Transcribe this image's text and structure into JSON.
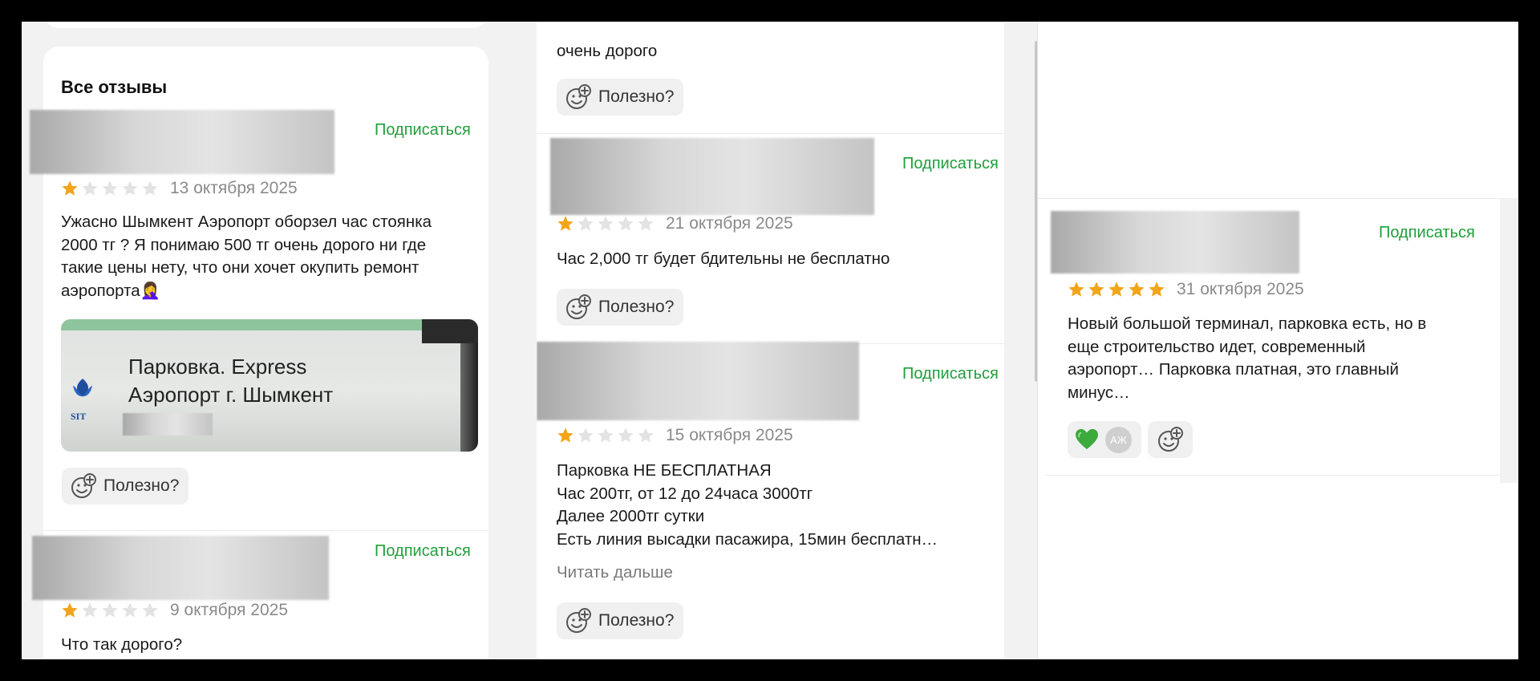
{
  "colors": {
    "accent": "#1f9f3a",
    "star": "#f2a51a",
    "star_empty": "#e3e3e3",
    "background": "#f2f2f2"
  },
  "left": {
    "heading": "Все отзывы",
    "reviews": [
      {
        "subscribe": "Подписаться",
        "rating": 1,
        "date": "13 октября 2025",
        "text": "Ужасно Шымкент Аэропорт оборзел час стоянка\n2000 тг ? Я понимаю 500 тг очень дорого ни где\nтакие цены нету, что они хочет окупить ремонт\nаэропорта🤦‍♀️",
        "photo": {
          "line1": "Парковка. Express",
          "line2": "Аэропорт г. Шымкент",
          "logo": "SIT"
        },
        "useful": "Полезно?"
      },
      {
        "subscribe": "Подписаться",
        "rating": 1,
        "date": "9 октября 2025",
        "text": "Что так дорого?"
      }
    ]
  },
  "middle": {
    "reviews": [
      {
        "text": "очень дорого",
        "useful": "Полезно?"
      },
      {
        "subscribe": "Подписаться",
        "rating": 1,
        "date": "21 октября 2025",
        "text": "Час 2,000 тг будет бдительны не бесплатно",
        "useful": "Полезно?"
      },
      {
        "subscribe": "Подписаться",
        "rating": 1,
        "date": "15 октября 2025",
        "text": "Парковка НЕ БЕСПЛАТНАЯ\nЧас 200тг, от 12 до 24часа 3000тг\nДалее 2000тг сутки\nЕсть линия высадки пасажира, 15мин бесплатн…",
        "read_more": "Читать дальше",
        "useful": "Полезно?"
      }
    ]
  },
  "right": {
    "reviews": [
      {
        "subscribe": "Подписаться",
        "rating": 5,
        "date": "31 октября 2025",
        "text": "Новый большой терминал, парковка есть, но в\nеще строительство идет, современный\nаэропорт… Парковка платная, это главный\nминус…",
        "reaction_avatar": "АЖ"
      }
    ]
  }
}
